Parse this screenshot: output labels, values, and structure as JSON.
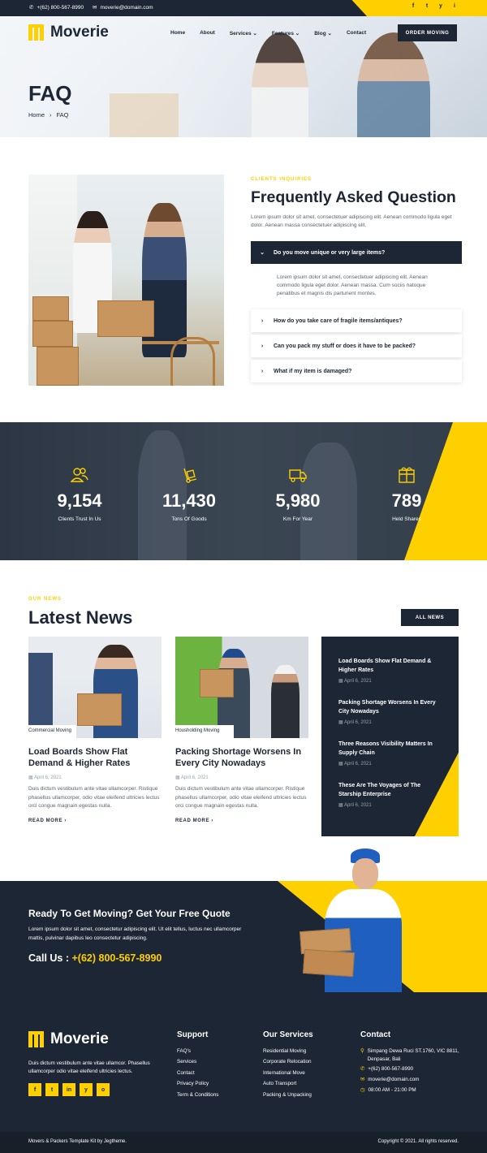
{
  "topbar": {
    "phone": "+(62) 800-567-8990",
    "email": "moverie@domain.com",
    "social": [
      "f",
      "t",
      "y",
      "i"
    ]
  },
  "brand": {
    "name": "Moverie"
  },
  "nav": {
    "items": [
      "Home",
      "About",
      "Services",
      "Features",
      "Blog",
      "Contact"
    ],
    "cta": "ORDER MOVING"
  },
  "hero": {
    "title": "FAQ",
    "breadcrumb": [
      "Home",
      "FAQ"
    ]
  },
  "faq": {
    "eyebrow": "CLIENTS INQUIRIES",
    "title": "Frequently Asked Question",
    "intro": "Lorem ipsum dolor sit amet, consectetuer adipiscing elit. Aenean commodo ligula eget dolor. Aenean massa consectetuer adipiscing elit.",
    "items": [
      {
        "q": "Do you move unique or very large items?",
        "a": "Lorem ipsum dolor sit amet, consectetuer adipiscing elit. Aenean commodo ligula eget dolor. Aenean massa. Cum sociis natoque penatibus et magnis dis parturient montes."
      },
      {
        "q": "How do you take care of fragile items/antiques?"
      },
      {
        "q": "Can you pack my stuff or does it have to be packed?"
      },
      {
        "q": "What if my item is damaged?"
      }
    ]
  },
  "stats": [
    {
      "icon": "users-icon",
      "value": "9,154",
      "label": "Clients Trust In Us"
    },
    {
      "icon": "hand-truck-icon",
      "value": "11,430",
      "label": "Tons Of Goods"
    },
    {
      "icon": "truck-icon",
      "value": "5,980",
      "label": "Km For Year"
    },
    {
      "icon": "package-icon",
      "value": "789",
      "label": "Held Shares"
    }
  ],
  "news": {
    "eyebrow": "OUR NEWS",
    "title": "Latest News",
    "all_button": "ALL NEWS",
    "cards": [
      {
        "tag": "Commercial Moving",
        "title": "Load Boards Show Flat Demand & Higher Rates",
        "date": "April 6, 2021",
        "text": "Duis dictum vestibulum ante vitae ullamcorper. Ristique phasellus ullamcorper, odio vitae eleifend ultricies lectus orci congue magnain egestas nulla.",
        "more": "READ MORE"
      },
      {
        "tag": "Housholding Moving",
        "title": "Packing Shortage Worsens In Every City Nowadays",
        "date": "April 6, 2021",
        "text": "Duis dictum vestibulum ante vitae ullamcorper. Ristique phasellus ullamcorper, odio vitae eleifend ultricies lectus orci congue magnain egestas nulla.",
        "more": "READ MORE"
      }
    ],
    "side": [
      {
        "title": "Load Boards Show Flat Demand & Higher Rates",
        "date": "April 6, 2021"
      },
      {
        "title": "Packing Shortage Worsens In Every City Nowadays",
        "date": "April 6, 2021"
      },
      {
        "title": "Three Reasons Visibility Matters In Supply Chain",
        "date": "April 6, 2021"
      },
      {
        "title": "These Are The Voyages of The Starship Enterprise",
        "date": "April 6, 2021"
      }
    ]
  },
  "cta": {
    "title": "Ready To Get Moving? Get Your Free Quote",
    "text": "Lorem ipsum dolor sit amet, consectetur adipiscing elit. Ut elit tellus, luctus nec ullamcorper mattis, pulvinar dapibus leo consectetur adipiscing.",
    "call_label": "Call Us :",
    "phone": "+(62) 800-567-8990"
  },
  "footer": {
    "about": "Duis dictum vestibulum ante vitae ullamcor. Phasellus ullamcorper odio vitae eleifend ultricies lectus.",
    "social": [
      "f",
      "t",
      "in",
      "y",
      "o"
    ],
    "support": {
      "title": "Support",
      "links": [
        "FAQ's",
        "Services",
        "Contact",
        "Privacy Policy",
        "Term & Conditions"
      ]
    },
    "services": {
      "title": "Our Services",
      "links": [
        "Residential Moving",
        "Corporate Relocation",
        "International Move",
        "Auto Transport",
        "Packing & Unpacking"
      ]
    },
    "contact": {
      "title": "Contact",
      "address": "Simpang Dewa Ruci ST.1760, VIC 8811, Denpasar, Bali",
      "phone": "+(62) 800-567-8990",
      "email": "moverie@domain.com",
      "hours": "08:00 AM - 21:00 PM"
    },
    "bottom_left": "Movers & Packers Template Kit by Jegtheme.",
    "bottom_right": "Copyright © 2021. All rights reserved."
  },
  "colors": {
    "navy": "#1c2634",
    "accent": "#ffd000"
  }
}
